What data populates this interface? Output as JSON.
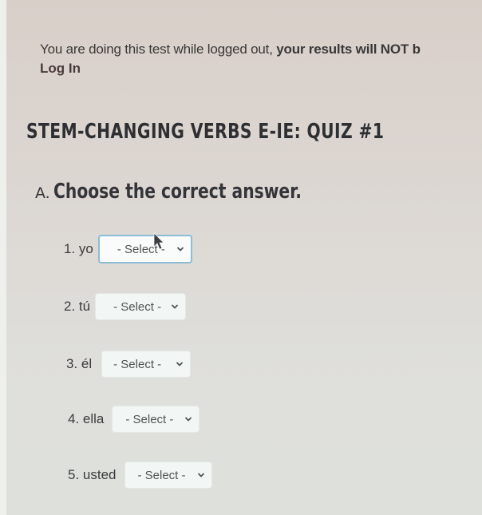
{
  "notice": {
    "text_prefix": "You are doing this test while logged out, ",
    "text_bold": "your results will NOT b",
    "login_label": "Log In"
  },
  "quiz": {
    "title": "STEM-CHANGING VERBS E-IE: QUIZ #1",
    "section_letter": "A.",
    "section_instruction": "Choose the correct answer."
  },
  "questions": [
    {
      "label": "1. yo",
      "selected": "- Select -",
      "focused": true
    },
    {
      "label": "2. tú",
      "selected": "- Select -",
      "focused": false
    },
    {
      "label": "3. él",
      "selected": "- Select -",
      "focused": false
    },
    {
      "label": "4. ella",
      "selected": "- Select -",
      "focused": false
    },
    {
      "label": "5. usted",
      "selected": "- Select -",
      "focused": false
    }
  ],
  "icons": {
    "dropdown": "chevron-down-icon",
    "pointer": "mouse-cursor-icon"
  },
  "colors": {
    "focus_border": "#8dbcd6",
    "text": "#3a3838"
  }
}
